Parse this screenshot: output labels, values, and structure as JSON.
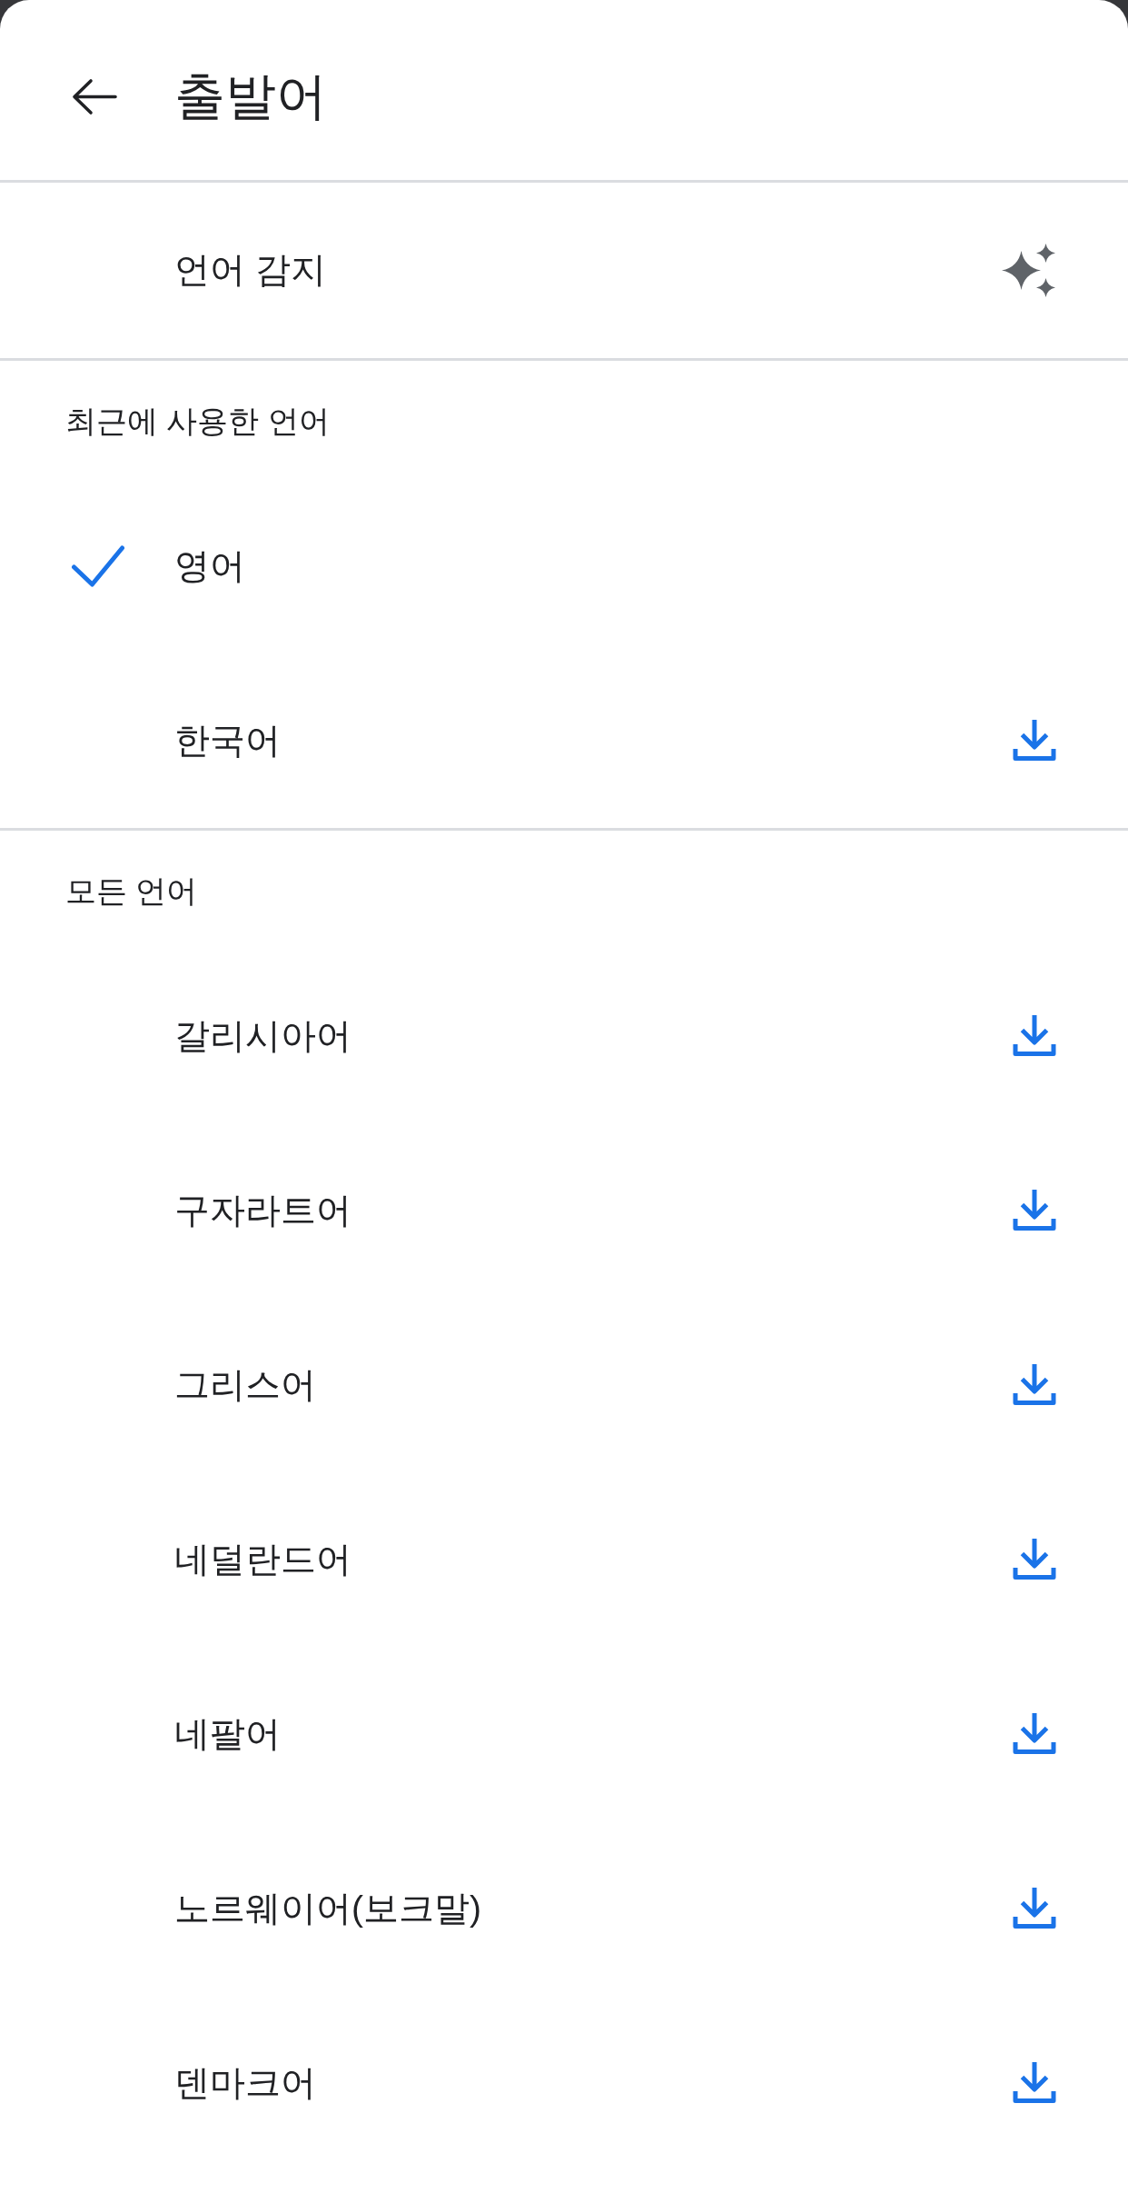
{
  "header": {
    "title": "출발어"
  },
  "detect_option": {
    "label": "언어 감지"
  },
  "sections": [
    {
      "heading": "최근에 사용한 언어",
      "items": [
        {
          "name": "영어",
          "selected": true,
          "downloaded": true
        },
        {
          "name": "한국어",
          "selected": false,
          "downloaded": false
        }
      ]
    },
    {
      "heading": "모든 언어",
      "items": [
        {
          "name": "갈리시아어",
          "selected": false,
          "downloaded": false
        },
        {
          "name": "구자라트어",
          "selected": false,
          "downloaded": false
        },
        {
          "name": "그리스어",
          "selected": false,
          "downloaded": false
        },
        {
          "name": "네덜란드어",
          "selected": false,
          "downloaded": false
        },
        {
          "name": "네팔어",
          "selected": false,
          "downloaded": false
        },
        {
          "name": "노르웨이어(보크말)",
          "selected": false,
          "downloaded": false
        },
        {
          "name": "덴마크어",
          "selected": false,
          "downloaded": false
        }
      ]
    }
  ]
}
